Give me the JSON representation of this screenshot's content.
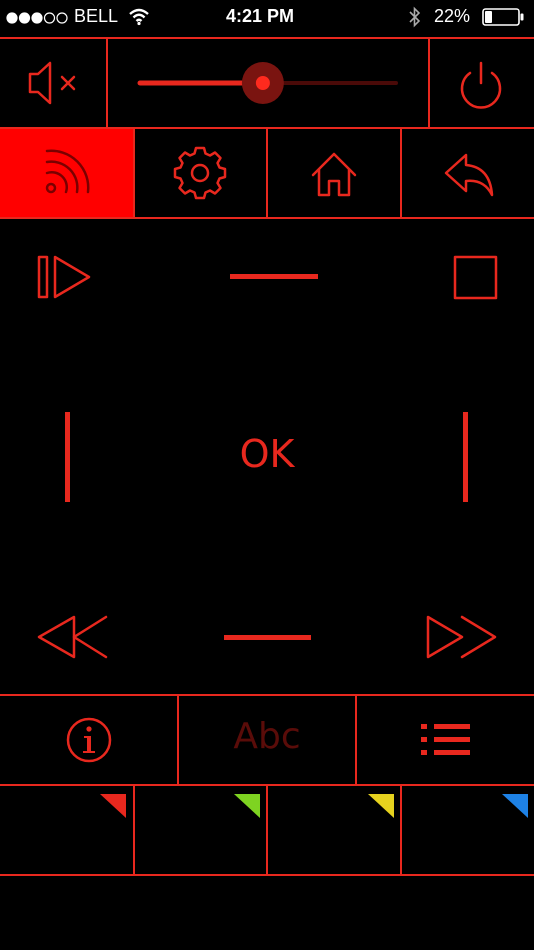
{
  "status_bar": {
    "carrier": "BELL",
    "time": "4:21 PM",
    "battery_percent": "22%",
    "signal_bars_filled": 3,
    "signal_bars_total": 5,
    "battery_level": 0.22
  },
  "top_row": {
    "mute_icon": "speaker-mute-icon",
    "volume_level": 0.48,
    "power_icon": "power-icon"
  },
  "nav_row": {
    "items": [
      {
        "icon": "cast-icon",
        "active": true
      },
      {
        "icon": "gear-icon",
        "active": false
      },
      {
        "icon": "home-icon",
        "active": false
      },
      {
        "icon": "back-arrow-icon",
        "active": false
      }
    ]
  },
  "dpad": {
    "ok_label": "OK"
  },
  "function_row": {
    "info_icon": "info-icon",
    "text_label": "Abc",
    "list_icon": "list-icon"
  },
  "color_keys": [
    {
      "name": "red",
      "color": "#e8281e"
    },
    {
      "name": "green",
      "color": "#7ed321"
    },
    {
      "name": "yellow",
      "color": "#e6d21e"
    },
    {
      "name": "blue",
      "color": "#1e82e6"
    }
  ],
  "colors": {
    "accent": "#e8281e",
    "background": "#000000",
    "active_tile": "#ff0000"
  }
}
